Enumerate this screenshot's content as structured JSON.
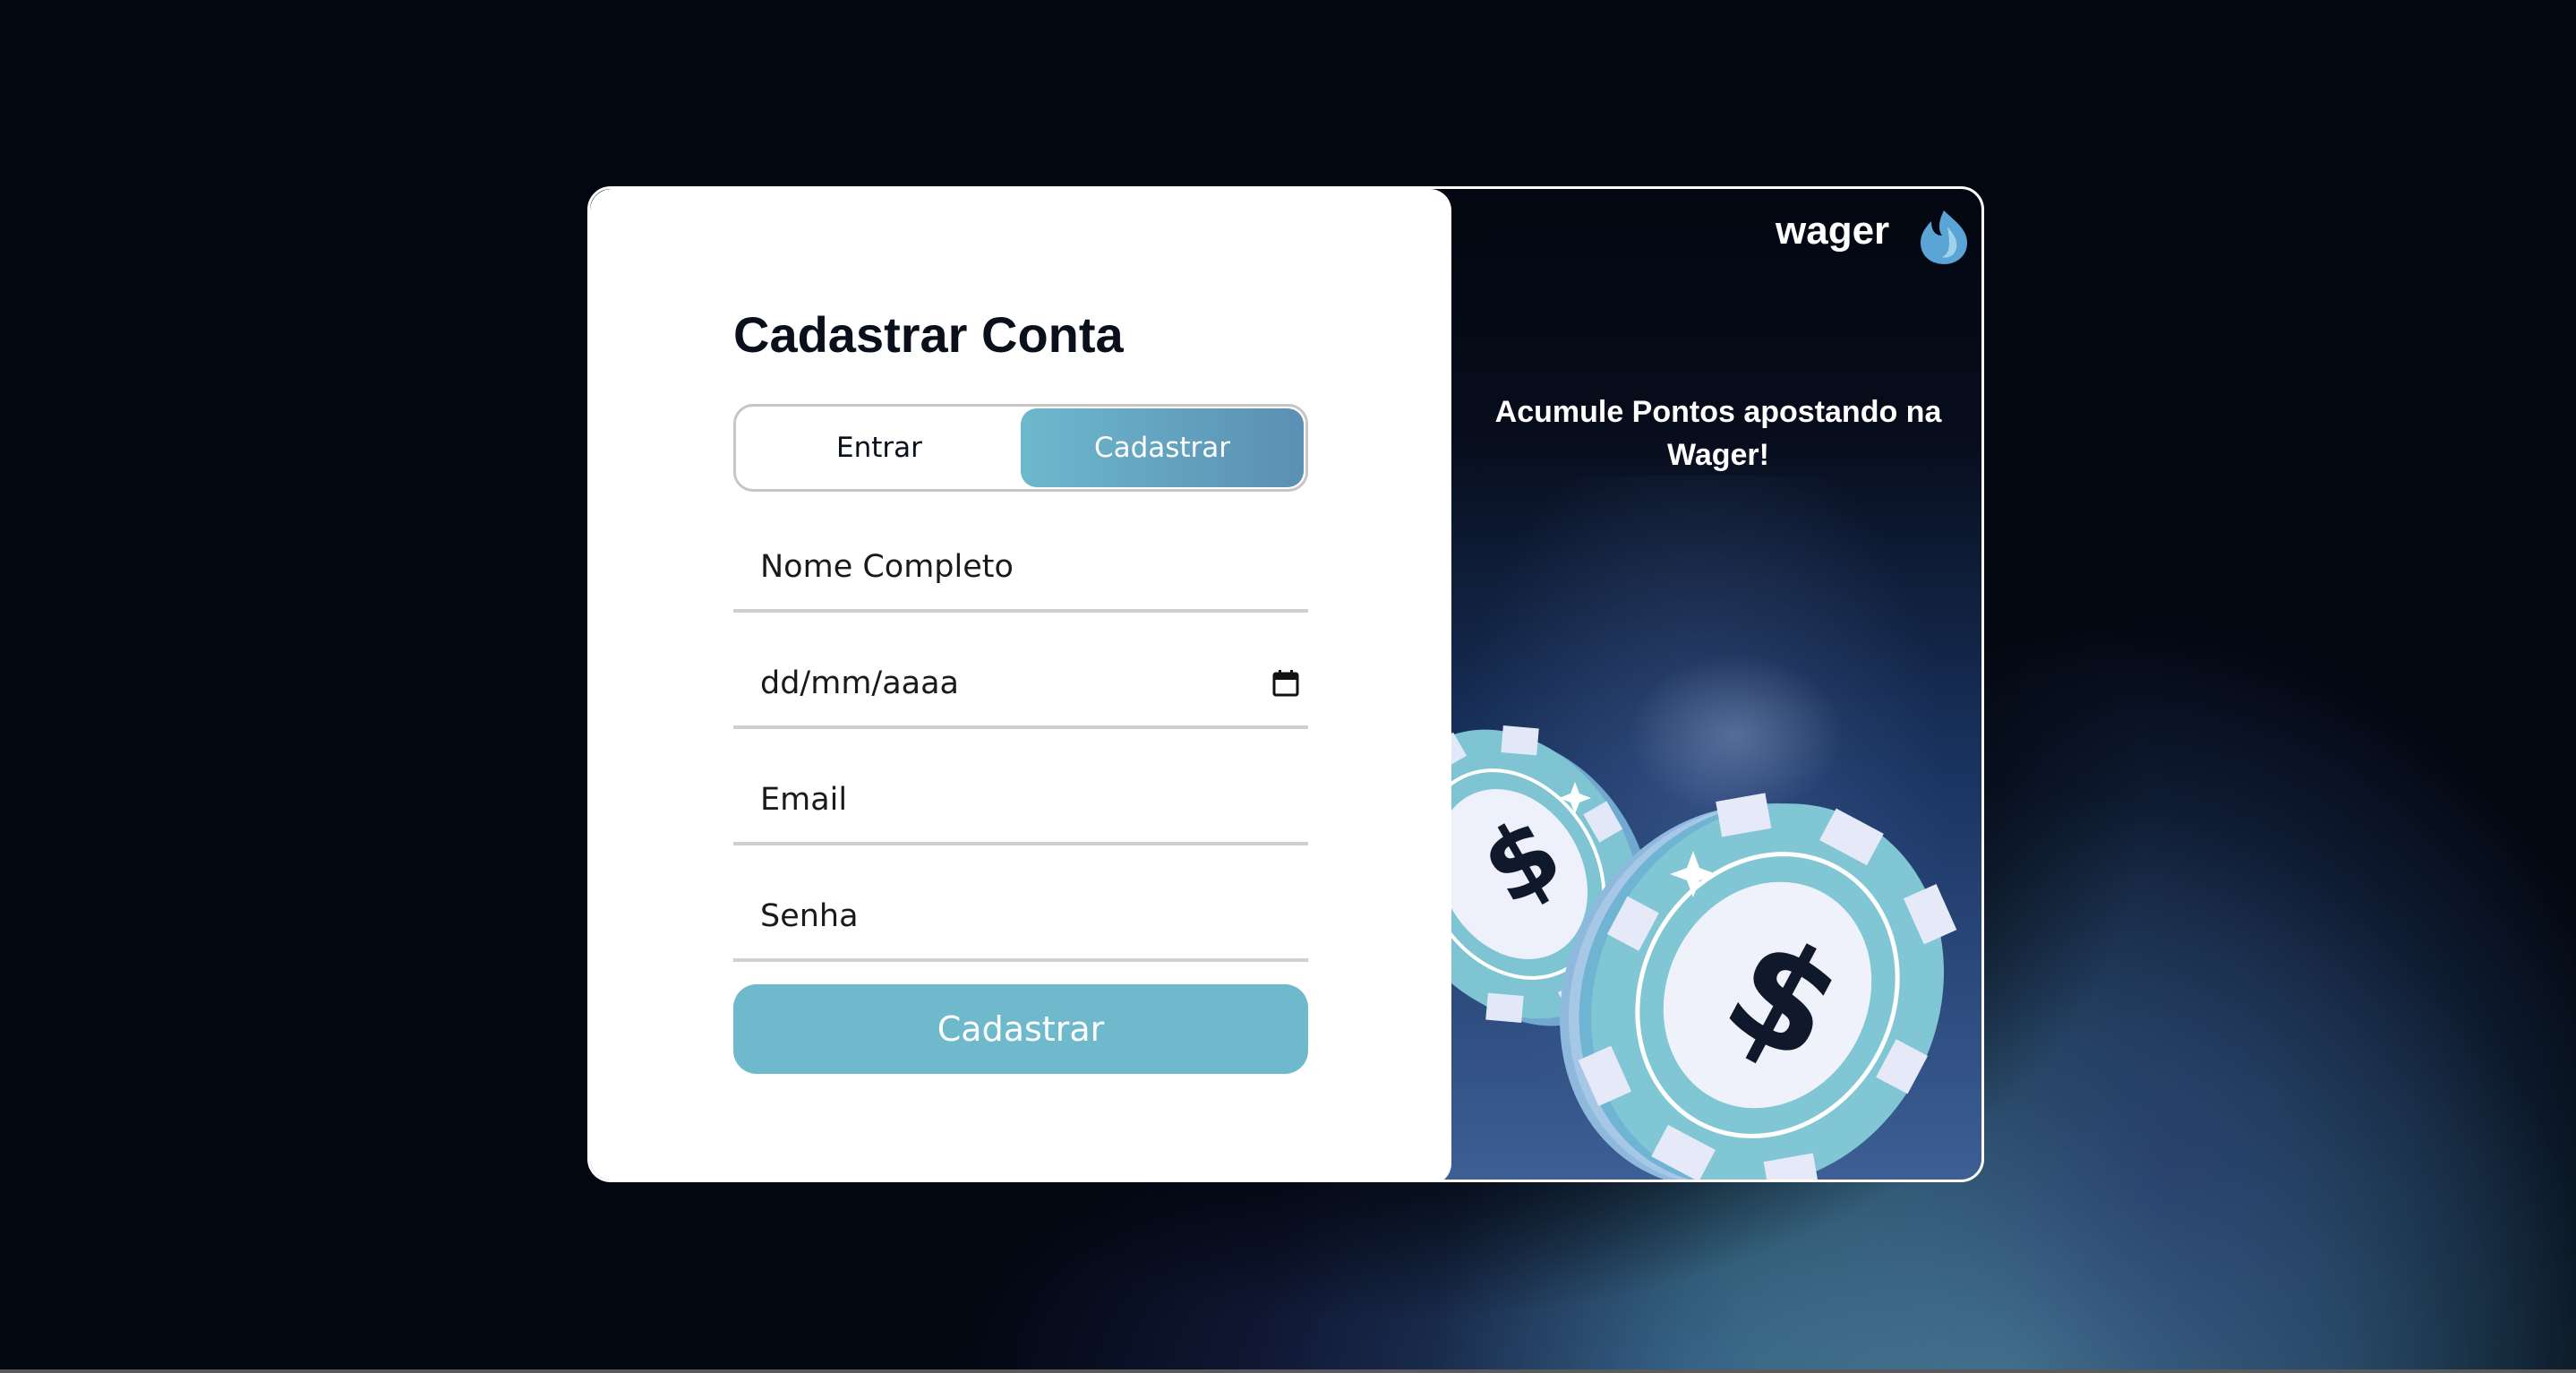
{
  "form": {
    "title": "Cadastrar Conta",
    "tabs": [
      {
        "label": "Entrar",
        "active": false
      },
      {
        "label": "Cadastrar",
        "active": true
      }
    ],
    "fields": {
      "name_placeholder": "Nome Completo",
      "date_placeholder": "dd/mm/aaaa",
      "email_placeholder": "Email",
      "password_placeholder": "Senha"
    },
    "submit_label": "Cadastrar"
  },
  "promo": {
    "logo_text": "wager",
    "tagline": "Acumule Pontos apostando na Wager!",
    "chip_icons": [
      "poker-chip-icon",
      "dollar-icon",
      "sparkle-icon"
    ]
  },
  "colors": {
    "accent": "#6fb9cd",
    "accent_dark": "#5b8fb3",
    "page_bg": "#030711",
    "title_text": "#0a0f1c"
  }
}
